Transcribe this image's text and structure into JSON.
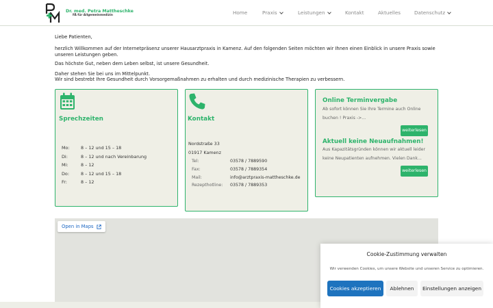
{
  "header": {
    "brand_name": "Dr. med. Petra Mattheschke",
    "brand_sub": "FÄ für Allgemeinmedizin",
    "nav": [
      {
        "label": "Home",
        "dropdown": false
      },
      {
        "label": "Praxis",
        "dropdown": true
      },
      {
        "label": "Leistungen",
        "dropdown": true
      },
      {
        "label": "Kontakt",
        "dropdown": false
      },
      {
        "label": "Aktuelles",
        "dropdown": false
      },
      {
        "label": "Datenschutz",
        "dropdown": true
      }
    ]
  },
  "intro": {
    "greeting": "Liebe Patienten,",
    "p1": "herzlich Willkommen auf der Internetpräsenz unserer Hausarztpraxis in Kamenz. Auf den folgenden Seiten möchten wir Ihnen einen Einblick in unsere Praxis sowie unseren Leistungen geben.",
    "p2": "Das höchste Gut, neben dem Leben selbst, ist unsere Gesundheit.",
    "p3a": "Daher stehen Sie bei uns im Mittelpunkt.",
    "p3b": "Wir sind bestrebt Ihre Gesundheit durch Vorsorgemaßnahmen zu erhalten und durch medizinische Therapien zu verbessern."
  },
  "sprechzeiten": {
    "title": "Sprechzeiten",
    "icon": "calendar-icon",
    "rows": [
      {
        "day": "Mo:",
        "hours": "8 – 12 und 15 – 18"
      },
      {
        "day": "Di:",
        "hours": "8 – 12 und nach Vereinbarung"
      },
      {
        "day": "Mi:",
        "hours": "8 – 12"
      },
      {
        "day": "Do:",
        "hours": "8 – 12 und 15 – 18"
      },
      {
        "day": "Fr:",
        "hours": "8 – 12"
      }
    ]
  },
  "kontakt": {
    "title": "Kontakt",
    "icon": "phone-icon",
    "street": "Nordstraße 33",
    "city": "01917 Kamenz",
    "rows": [
      {
        "label": "Tel:",
        "value": "03578 / 7889590"
      },
      {
        "label": "Fax:",
        "value": "03578 / 7889354"
      },
      {
        "label": "Mail:",
        "value": "info@arztpraxis-mattheschke.de"
      },
      {
        "label": "Rezepthotline:",
        "value": "03578 / 7889353"
      }
    ]
  },
  "news": {
    "online_title": "Online Terminvergabe",
    "online_text": "Ab sofort können Sie Ihre Termine auch Online buchen ! Praxis ->...",
    "more_label": "weiterlesen",
    "neu_title": "Aktuell keine Neuaufnahmen!",
    "neu_text": "Aus Kapazitätsgründen können wir aktuell leider keine Neupatienten aufnehmen. Vielen Dank..."
  },
  "map": {
    "link_label": "Open in Maps"
  },
  "cookie": {
    "title": "Cookie-Zustimmung verwalten",
    "text": "Wir verwenden Cookies, um unsere Website und unseren Service zu optimieren.",
    "accept": "Cookies akzeptieren",
    "deny": "Ablehnen",
    "settings": "Einstellungen anzeigen"
  },
  "colors": {
    "accent": "#2db36b",
    "card_bg": "#efefe6",
    "cookie_accept": "#1e73be"
  }
}
